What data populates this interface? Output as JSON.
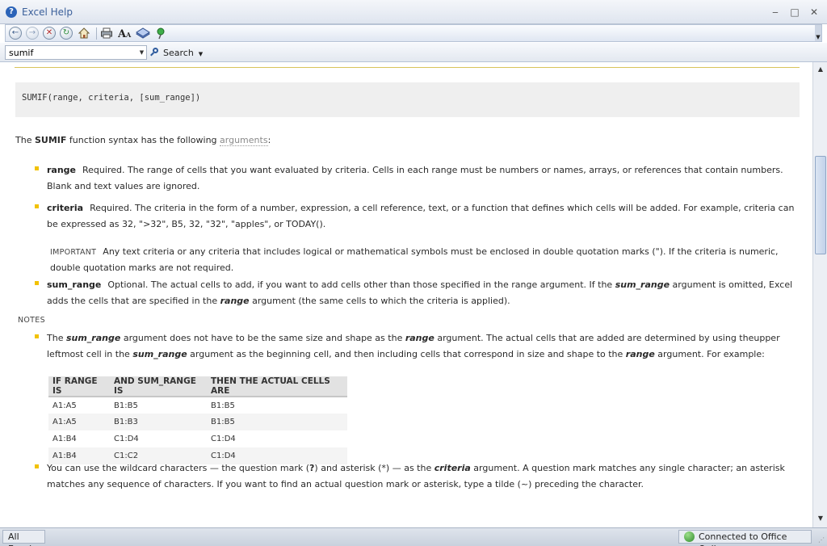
{
  "window": {
    "title": "Excel Help",
    "minimize": "‒",
    "maximize": "□",
    "close": "✕"
  },
  "search": {
    "value": "sumif",
    "button_label": "Search"
  },
  "syntax": "SUMIF(range, criteria, [sum_range])",
  "intro": {
    "pre": "The ",
    "fn": "SUMIF",
    "mid": " function syntax has the following ",
    "link": "arguments",
    "post": ":"
  },
  "arguments": [
    {
      "term": "range",
      "text": "Required. The range of cells that you want evaluated by criteria. Cells in each range must be numbers or names, arrays, or references that contain numbers. Blank and text values are ignored."
    },
    {
      "term": "criteria",
      "text": "Required. The criteria in the form of a number, expression, a cell reference, text, or a function that defines which cells will be added. For example, criteria can be expressed as 32, \">32\", B5, 32, \"32\", \"apples\", or TODAY()."
    }
  ],
  "important": {
    "label": "IMPORTANT",
    "text": "Any text criteria or any criteria that includes logical or mathematical symbols must be enclosed in double quotation marks (\"). If the criteria is numeric, double quotation marks are not required."
  },
  "sum_range": {
    "term": "sum_range",
    "t1": "Optional. The actual cells to add, if you want to add cells other than those specified in the range argument. If the ",
    "em1": "sum_range",
    "t2": " argument is omitted, Excel adds the cells that are specified in the ",
    "em2": "range",
    "t3": " argument (the same cells to which the criteria is applied)."
  },
  "notes_label": "NOTES",
  "note1": {
    "t1": "The ",
    "em1": "sum_range",
    "t2": " argument does not have to be the same size and shape as the ",
    "em2": "range",
    "t3": " argument. The actual cells that are added are determined by using theupper leftmost cell in the ",
    "em3": "sum_range",
    "t4": " argument as the beginning cell, and then including cells that correspond in size and shape to the ",
    "em4": "range",
    "t5": " argument. For example:"
  },
  "table": {
    "headers": [
      "IF RANGE IS",
      "AND SUM_RANGE IS",
      "THEN THE ACTUAL CELLS ARE"
    ],
    "rows": [
      [
        "A1:A5",
        "B1:B5",
        "B1:B5"
      ],
      [
        "A1:A5",
        "B1:B3",
        "B1:B5"
      ],
      [
        "A1:B4",
        "C1:D4",
        "C1:D4"
      ],
      [
        "A1:B4",
        "C1:C2",
        "C1:D4"
      ]
    ]
  },
  "note2": {
    "t1": "You can use the wildcard characters — the question mark (",
    "b1": "?",
    "t2": ") and asterisk (*) — as the ",
    "em1": "criteria",
    "t3": " argument. A question mark matches any single character; an asterisk matches any sequence of characters. If you want to find an actual question mark or asterisk, type a tilde (~) preceding the character."
  },
  "status": {
    "left": "All Excel",
    "right": "Connected to Office Online"
  },
  "colors": {
    "bullet": "#f2c200",
    "rule": "#d9c35a",
    "title": "#3a5f9a"
  }
}
